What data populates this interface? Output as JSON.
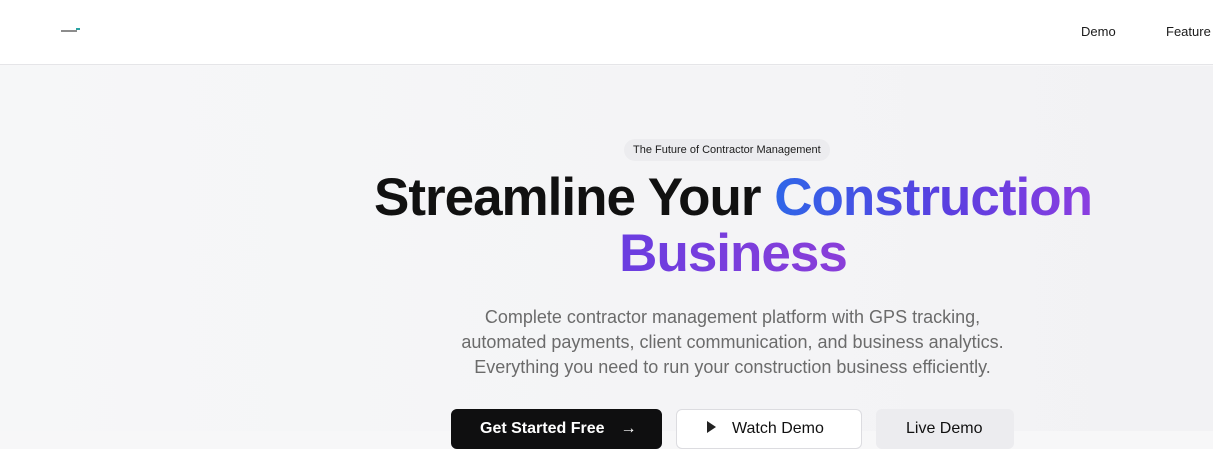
{
  "header": {
    "logo_alt": "",
    "nav": [
      {
        "label": "Demo"
      },
      {
        "label": "Feature"
      }
    ]
  },
  "hero": {
    "pill": "The Future of Contractor Management",
    "headline_part1": "Streamline Your ",
    "headline_part2": "Construction",
    "headline_part3": "Business",
    "subtext_line1": "Complete contractor management platform with GPS tracking,",
    "subtext_line2": "automated payments, client communication, and business analytics.",
    "subtext_line3": "Everything you need to run your construction business efficiently.",
    "buttons": {
      "primary": "Get Started Free",
      "secondary": "Watch Demo",
      "ghost": "Live Demo"
    }
  },
  "colors": {
    "accent_start": "#2f66e8",
    "accent_end": "#8b3ee0",
    "primary_button": "#0f0f10"
  },
  "icons": {
    "arrow": "arrow-right-icon",
    "play": "play-icon"
  }
}
